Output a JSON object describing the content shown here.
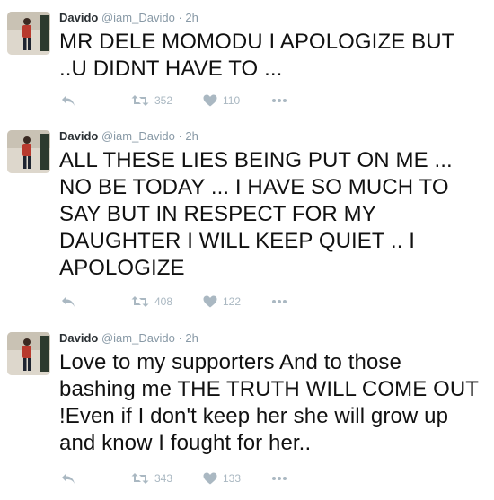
{
  "tweets": [
    {
      "name": "Davido",
      "handle": "@iam_Davido",
      "time": "2h",
      "text": "MR DELE MOMODU I APOLOGIZE BUT ..U DIDNT HAVE TO ...",
      "retweets": "352",
      "likes": "110"
    },
    {
      "name": "Davido",
      "handle": "@iam_Davido",
      "time": "2h",
      "text": "ALL THESE LIES BEING PUT ON ME ... NO BE TODAY ... I HAVE SO MUCH TO SAY BUT IN RESPECT FOR MY DAUGHTER I WILL KEEP QUIET .. I APOLOGIZE",
      "retweets": "408",
      "likes": "122"
    },
    {
      "name": "Davido",
      "handle": "@iam_Davido",
      "time": "2h",
      "text": "Love to my supporters And to those bashing me THE TRUTH WILL COME OUT !Even if I don't keep her she will grow up and know I fought for her..",
      "retweets": "343",
      "likes": "133"
    }
  ],
  "separator": "·",
  "icons": {
    "reply": "reply-icon",
    "retweet": "retweet-icon",
    "like": "heart-icon",
    "more": "more-dots-icon"
  },
  "colors": {
    "action_gray": "#aab8c2",
    "meta_gray": "#8899a6",
    "divider": "#e1e8ed"
  }
}
